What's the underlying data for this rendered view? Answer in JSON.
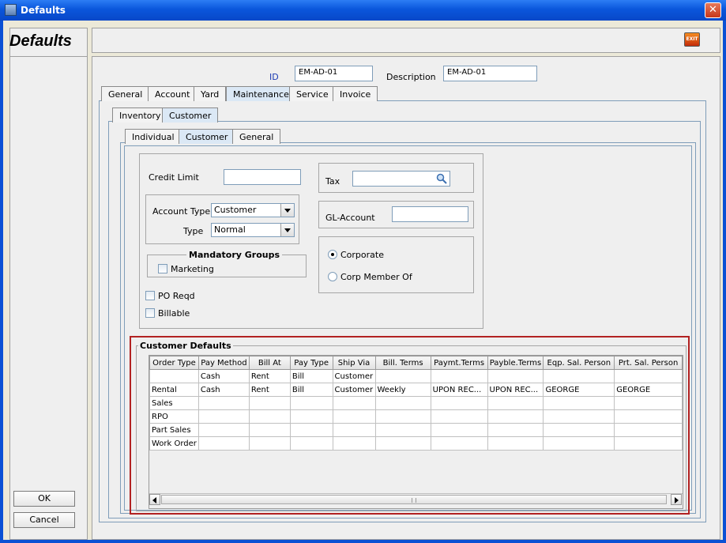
{
  "window": {
    "title": "Defaults",
    "close_glyph": "✕"
  },
  "header": {
    "title": "Defaults",
    "exit_label": "EXIT"
  },
  "left_buttons": {
    "ok": "OK",
    "cancel": "Cancel"
  },
  "form": {
    "id_label": "ID",
    "id_value": "EM-AD-01",
    "description_label": "Description",
    "description_value": "EM-AD-01"
  },
  "tabs_main": [
    "General",
    "Account",
    "Yard",
    "Maintenance",
    "Service",
    "Invoice"
  ],
  "tabs_sub1": [
    "Inventory",
    "Customer"
  ],
  "tabs_sub2": [
    "Individual",
    "Customer",
    "General"
  ],
  "customer": {
    "credit_limit_label": "Credit Limit",
    "credit_limit_value": "",
    "account_type_label": "Account Type",
    "account_type_value": "Customer",
    "type_label": "Type",
    "type_value": "Normal",
    "mandatory_groups_label": "Mandatory Groups",
    "marketing_label": "Marketing",
    "po_reqd_label": "PO Reqd",
    "billable_label": "Billable",
    "tax_label": "Tax",
    "tax_value": "",
    "gl_account_label": "GL-Account",
    "gl_account_value": "",
    "corporate_label": "Corporate",
    "corp_member_label": "Corp Member Of"
  },
  "customer_defaults": {
    "title": "Customer Defaults",
    "columns": [
      "Order Type",
      "Pay Method",
      "Bill At",
      "Pay Type",
      "Ship Via",
      "Bill. Terms",
      "Paymt.Terms",
      "Payble.Terms",
      "Eqp. Sal. Person",
      "Prt. Sal. Person"
    ],
    "rows": [
      [
        "",
        "Cash",
        "Rent",
        "Bill",
        "Customer",
        "",
        "",
        "",
        "",
        ""
      ],
      [
        "Rental",
        "Cash",
        "Rent",
        "Bill",
        "Customer",
        "Weekly",
        "UPON REC...",
        "UPON REC...",
        "GEORGE",
        "GEORGE"
      ],
      [
        "Sales",
        "",
        "",
        "",
        "",
        "",
        "",
        "",
        "",
        ""
      ],
      [
        "RPO",
        "",
        "",
        "",
        "",
        "",
        "",
        "",
        "",
        ""
      ],
      [
        "Part Sales",
        "",
        "",
        "",
        "",
        "",
        "",
        "",
        "",
        ""
      ],
      [
        "Work Order",
        "",
        "",
        "",
        "",
        "",
        "",
        "",
        "",
        ""
      ]
    ]
  },
  "colors": {
    "titlebar": "#0a56dc",
    "accent_red": "#b22222",
    "tab_active": "#dbe8f5"
  }
}
